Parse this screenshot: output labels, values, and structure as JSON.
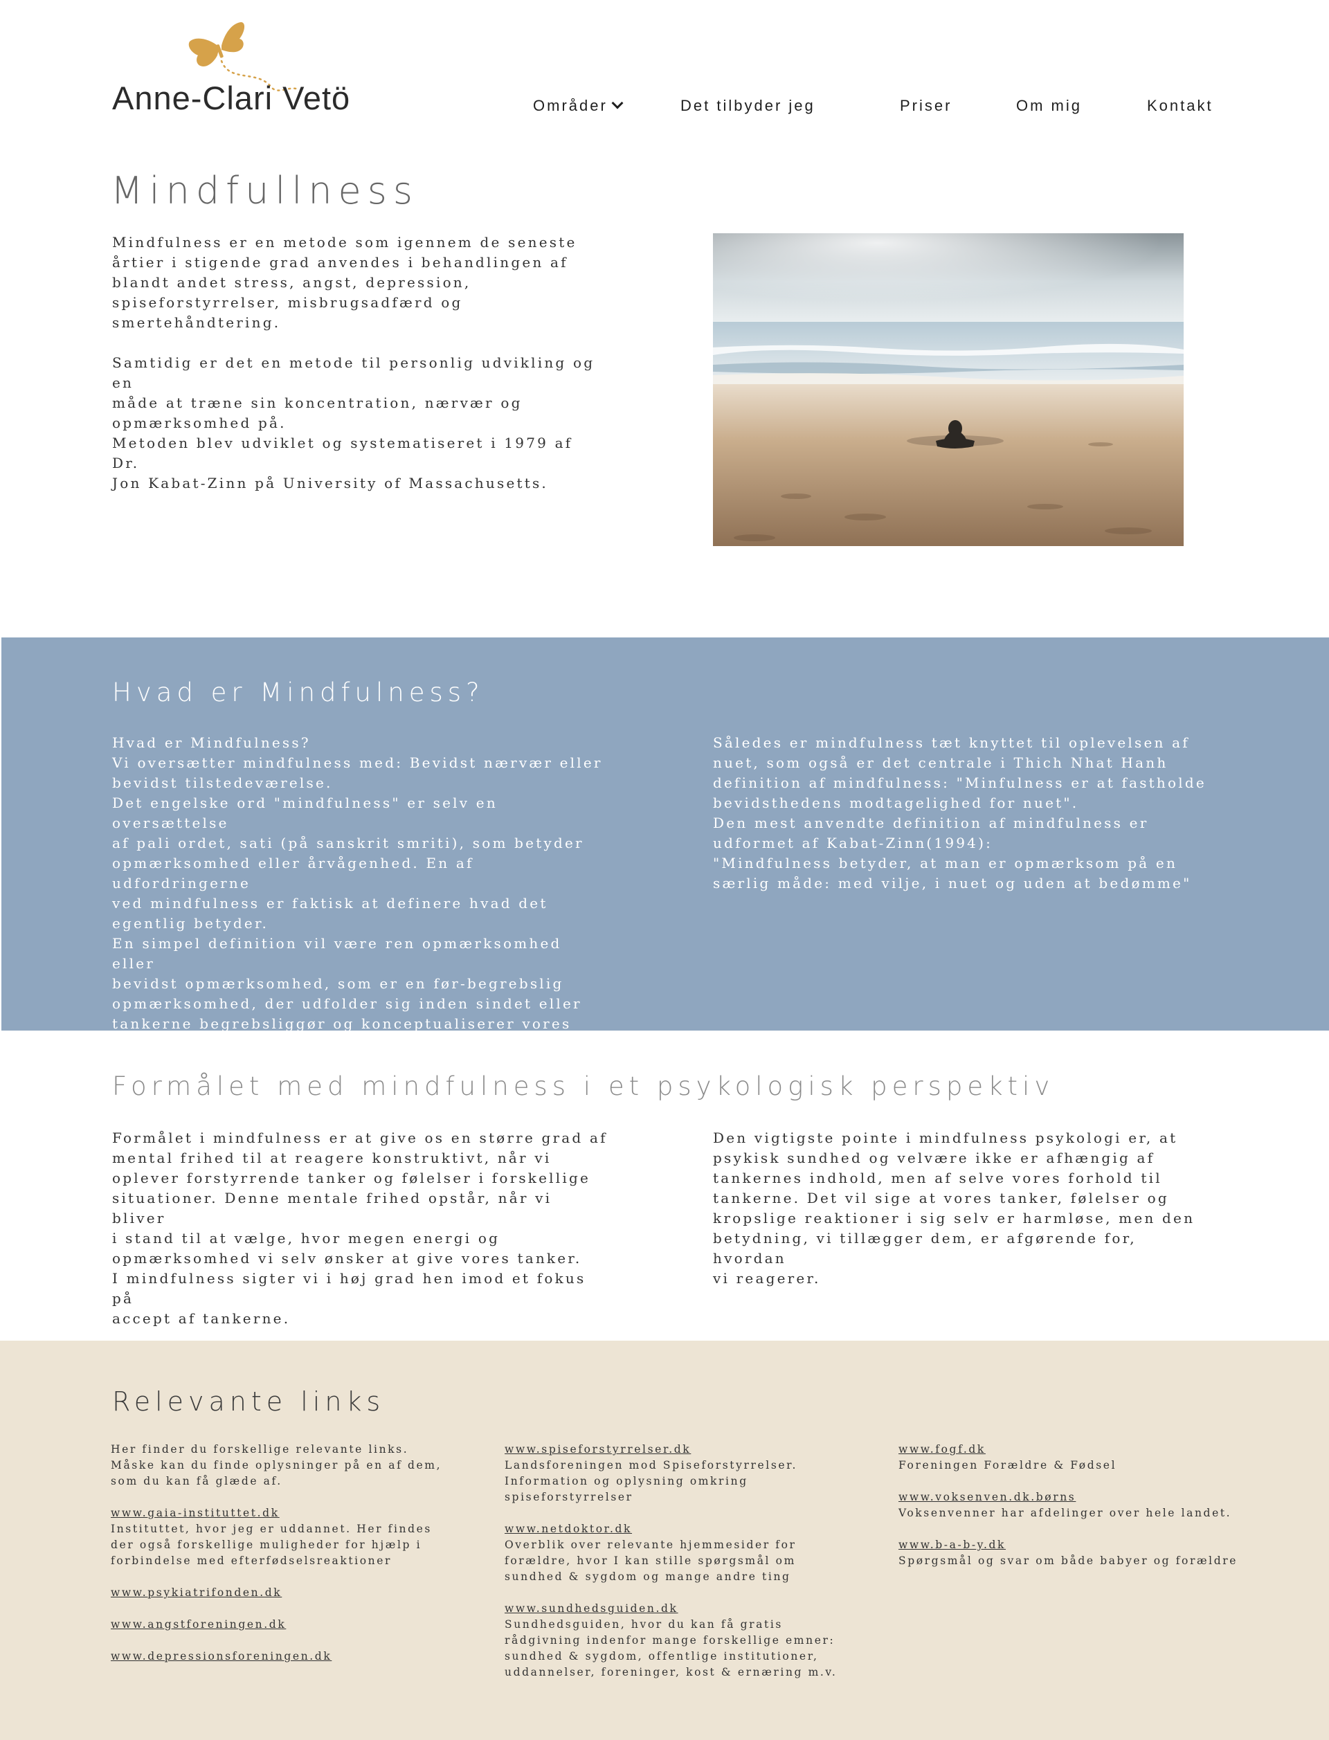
{
  "brand": {
    "name": "Anne-Clari Vetö",
    "accent_color": "#d6a24a"
  },
  "nav": {
    "items": [
      {
        "label": "Områder",
        "has_dropdown": true
      },
      {
        "label": "Det tilbyder jeg"
      },
      {
        "label": "Priser"
      },
      {
        "label": "Om mig"
      },
      {
        "label": "Kontakt"
      }
    ]
  },
  "intro": {
    "title": "Mindfullness",
    "p1": "Mindfulness er en metode som igennem de seneste\nårtier i stigende grad anvendes i behandlingen af\nblandt andet stress, angst, depression,\nspiseforstyrrelser, misbrugsadfærd og\nsmertehåndtering.",
    "p2": "Samtidig er det en metode til personlig udvikling og en\nmåde at træne sin koncentration, nærvær og\nopmærksomhed på.\nMetoden blev udviklet og systematiseret i 1979 af Dr.\nJon Kabat-Zinn på University of Massachusetts."
  },
  "what_is": {
    "title": "Hvad er Mindfulness?",
    "bg_color": "#8fa6bf",
    "left": "Hvad er Mindfulness?\nVi oversætter mindfulness med: Bevidst nærvær eller\nbevidst tilstedeværelse.\nDet engelske ord \"mindfulness\" er selv en oversættelse\naf pali ordet, sati (på sanskrit smriti), som betyder\nopmærksomhed eller årvågenhed. En af udfordringerne\nved mindfulness er faktisk at definere hvad det\negentlig betyder.\nEn simpel definition vil være ren opmærksomhed eller\nbevidst opmærksomhed, som er en før-begrebslig\nopmærksomhed, der udfolder sig inden sindet eller\ntankerne begrebsliggør og konceptualiserer vores\noplevelse.",
    "right": "Således er mindfulness tæt knyttet til oplevelsen af\nnuet, som også er det centrale i Thich Nhat Hanh\ndefinition af mindfulness: \"Minfulness er at fastholde\nbevidsthedens modtagelighed for nuet\".\nDen mest anvendte definition af mindfulness er\nudformet af Kabat-Zinn(1994):\n\"Mindfulness betyder, at man er opmærksom på en\nsærlig måde: med vilje, i nuet og uden at bedømme\""
  },
  "purpose": {
    "title": "Formålet med mindfulness i et psykologisk perspektiv",
    "left": "Formålet i mindfulness er at give os en større grad af\nmental frihed til at reagere konstruktivt, når vi\noplever forstyrrende tanker og følelser i forskellige\nsituationer. Denne mentale frihed opstår, når vi bliver\ni stand til at vælge, hvor megen energi og\nopmærksomhed vi selv ønsker at give vores tanker.\nI mindfulness sigter vi i høj grad hen imod et fokus på\naccept af tankerne.",
    "right": "Den vigtigste pointe i mindfulness psykologi er, at\npsykisk sundhed og velvære ikke er afhængig af\ntankernes indhold, men af selve vores forhold til\ntankerne. Det vil sige at vores tanker, følelser og\nkropslige reaktioner i sig selv er harmløse, men den\nbetydning, vi tillægger dem, er afgørende for, hvordan\nvi reagerer."
  },
  "links": {
    "title": "Relevante links",
    "bg_color": "#ede4d4",
    "col1": {
      "intro": "Her finder du forskellige relevante links.\nMåske kan du finde oplysninger på en af dem,\nsom du kan få glæde af.",
      "items": [
        {
          "link": "www.gaia-instituttet.dk",
          "desc": "Instituttet, hvor jeg er uddannet. Her findes\nder også forskellige muligheder for hjælp i\nforbindelse med efterfødselsreaktioner"
        },
        {
          "link": "www.psykiatrifonden.dk",
          "desc": ""
        },
        {
          "link": "www.angstforeningen.dk",
          "desc": ""
        },
        {
          "link": "www.depressionsforeningen.dk",
          "desc": ""
        }
      ]
    },
    "col2": {
      "items": [
        {
          "link": "www.spiseforstyrrelser.dk",
          "desc": "Landsforeningen mod Spiseforstyrrelser.\nInformation og oplysning omkring\nspiseforstyrrelser"
        },
        {
          "link": "www.netdoktor.dk",
          "desc": "Overblik over relevante hjemmesider for\nforældre, hvor I kan stille spørgsmål om\nsundhed & sygdom og mange andre ting"
        },
        {
          "link": "www.sundhedsguiden.dk",
          "desc": "Sundhedsguiden, hvor du kan få gratis\nrådgivning indenfor mange forskellige emner:\nsundhed & sygdom, offentlige institutioner,\nuddannelser, foreninger, kost & ernæring m.v."
        }
      ]
    },
    "col3": {
      "items": [
        {
          "link": "www.fogf.dk",
          "desc": "Foreningen Forældre & Fødsel"
        },
        {
          "link": "www.voksenven.dk.børns",
          "desc": "Voksenvenner har afdelinger over hele landet."
        },
        {
          "link": "www.b-a-b-y.dk",
          "desc": "Spørgsmål og svar om både babyer og forældre"
        }
      ]
    }
  }
}
